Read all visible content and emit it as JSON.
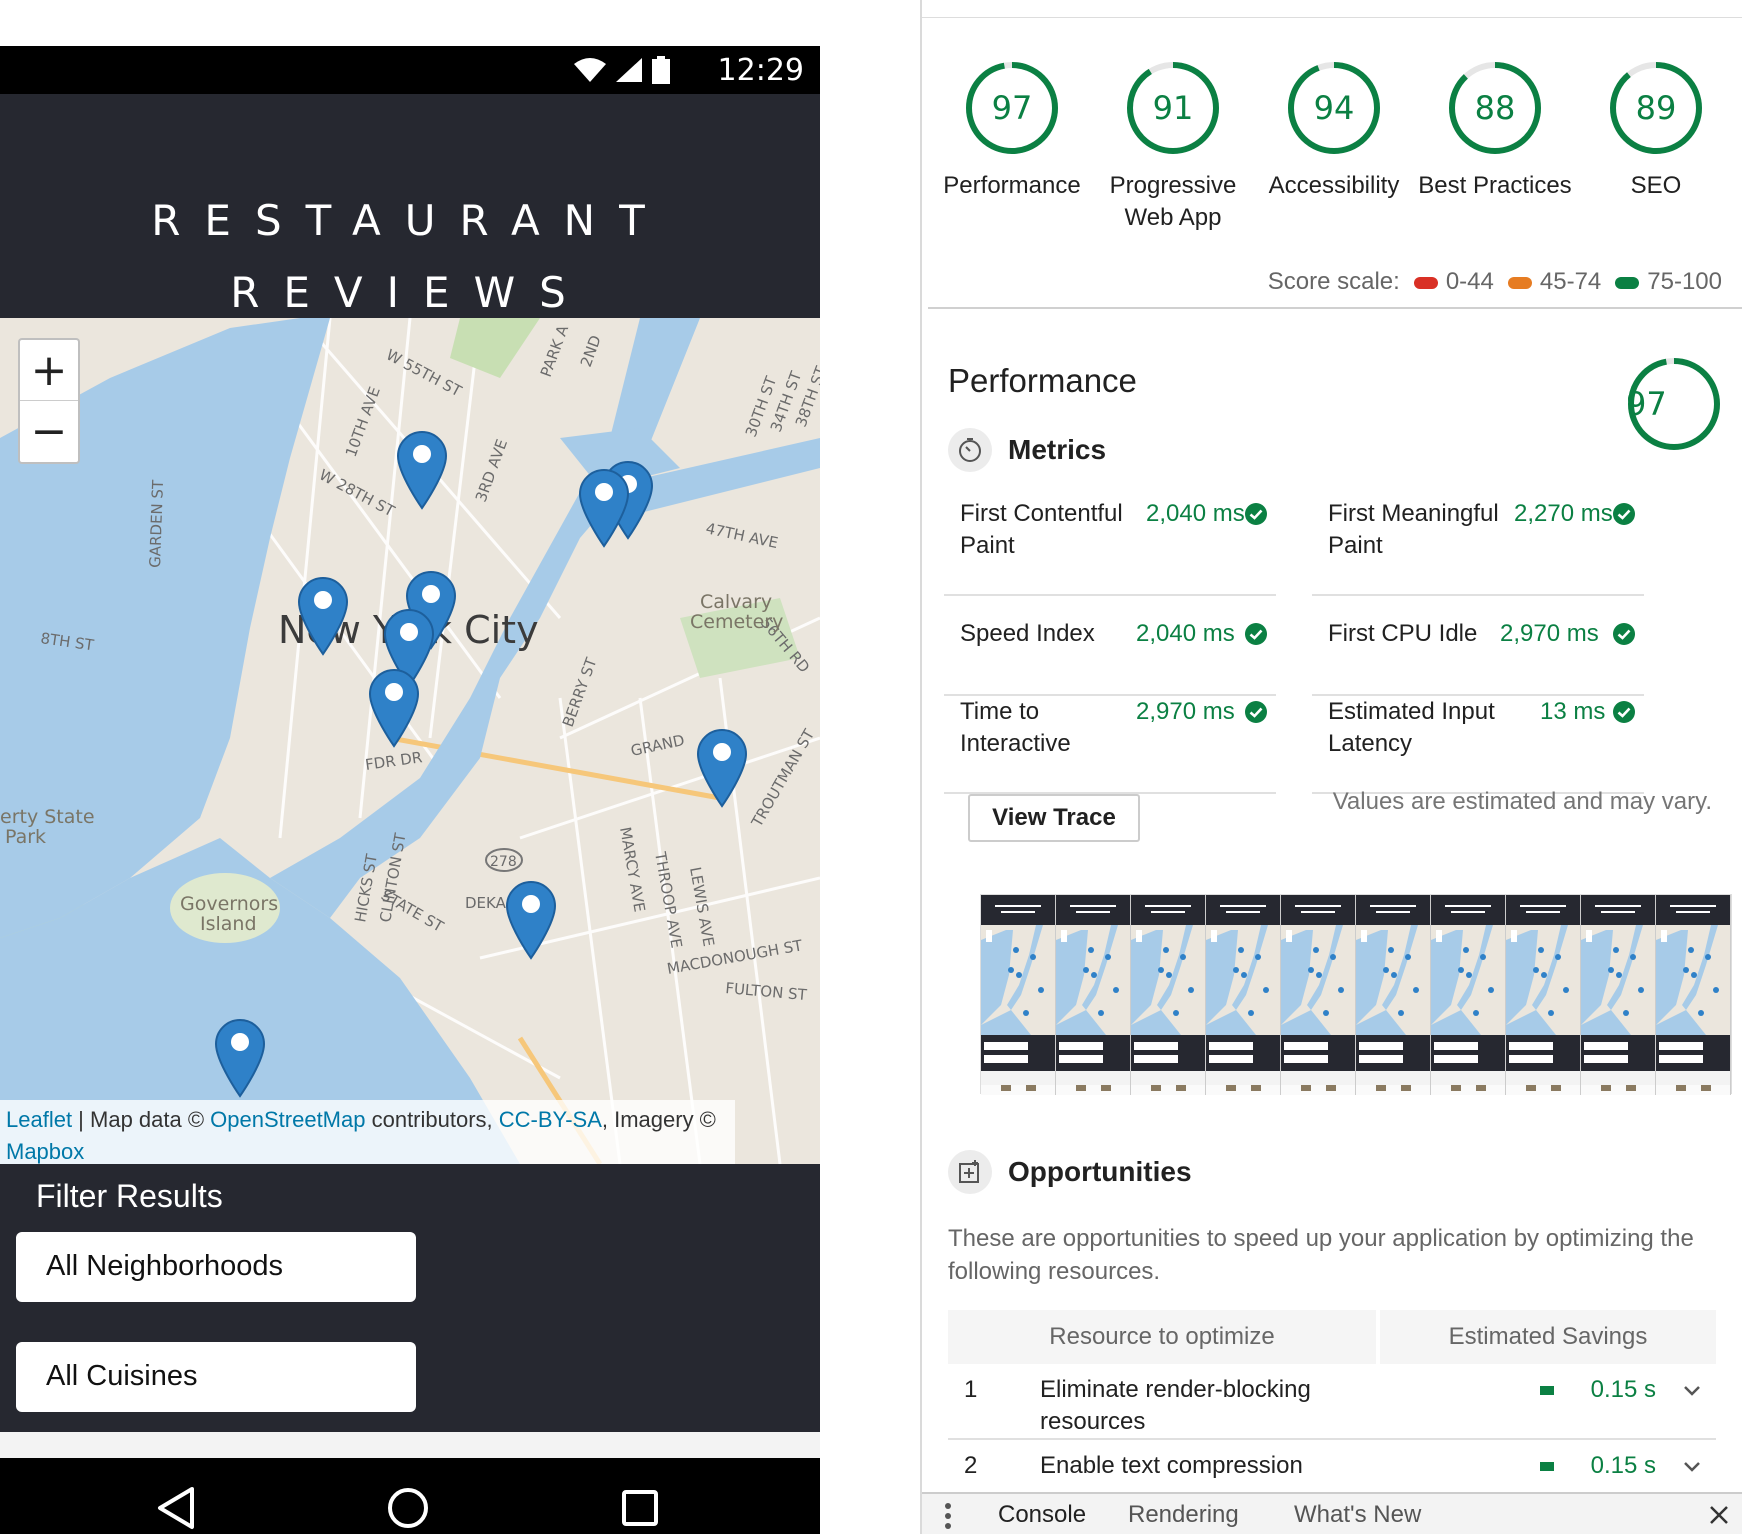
{
  "phone": {
    "status_time": "12:29",
    "app_title_line1": "RESTAURANT",
    "app_title_line2": "REVIEWS",
    "map": {
      "zoom_in": "+",
      "zoom_out": "−",
      "city_label": "New York City",
      "street_labels": [
        "W 55TH ST",
        "10TH AVE",
        "W 28TH ST",
        "3RD AVE",
        "PARK A",
        "2ND",
        "30TH ST",
        "34TH ST",
        "38TH ST",
        "47TH AVE",
        "Calvary Cemetery",
        "56TH RD",
        "GARDEN ST",
        "8TH ST",
        "BERRY ST",
        "GRAND",
        "TROUTMAN ST",
        "FDR DR",
        "erty State Park",
        "Governors Island",
        "HICKS ST",
        "CLINTON ST",
        "STATE ST",
        "DEKA",
        "MARCY AVE",
        "THROOP AVE",
        "LEWIS AVE",
        "MACDONOUGH ST",
        "FULTON ST",
        "278"
      ],
      "attribution": {
        "leaflet": "Leaflet",
        "sep1": " | Map data © ",
        "osm": "OpenStreetMap",
        "sep2": " contributors, ",
        "license": "CC-BY-SA",
        "sep3": ", Imagery © ",
        "mapbox": "Mapbox"
      }
    },
    "filter": {
      "title": "Filter Results",
      "neighborhoods": "All Neighborhoods",
      "cuisines": "All Cuisines"
    }
  },
  "lighthouse": {
    "gauges": [
      {
        "score": 97,
        "label": "Performance"
      },
      {
        "score": 91,
        "label": "Progressive Web App"
      },
      {
        "score": 94,
        "label": "Accessibility"
      },
      {
        "score": 88,
        "label": "Best Practices"
      },
      {
        "score": 89,
        "label": "SEO"
      }
    ],
    "score_scale": {
      "label": "Score scale:",
      "ranges": [
        {
          "range": "0-44",
          "color": "#d93025"
        },
        {
          "range": "45-74",
          "color": "#e67c22"
        },
        {
          "range": "75-100",
          "color": "#0b8043"
        }
      ]
    },
    "performance": {
      "title": "Performance",
      "score": 97,
      "metrics_title": "Metrics",
      "metrics": [
        {
          "name_line1": "First Contentful",
          "name_line2": "Paint",
          "value": "2,040 ms"
        },
        {
          "name_line1": "First Meaningful",
          "name_line2": "Paint",
          "value": "2,270 ms"
        },
        {
          "name_line1": "Speed Index",
          "name_line2": "",
          "value": "2,040 ms"
        },
        {
          "name_line1": "First CPU Idle",
          "name_line2": "",
          "value": "2,970 ms"
        },
        {
          "name_line1": "Time to",
          "name_line2": "Interactive",
          "value": "2,970 ms"
        },
        {
          "name_line1": "Estimated Input",
          "name_line2": "Latency",
          "value": "13 ms"
        }
      ],
      "view_trace": "View Trace",
      "estimate_note": "Values are estimated and may vary."
    },
    "opportunities": {
      "title": "Opportunities",
      "description": "These are opportunities to speed up your application by optimizing the following resources.",
      "col_resource": "Resource to optimize",
      "col_savings": "Estimated Savings",
      "rows": [
        {
          "num": "1",
          "label": "Eliminate render-blocking resources",
          "savings": "0.15 s"
        },
        {
          "num": "2",
          "label": "Enable text compression",
          "savings": "0.15 s"
        }
      ]
    },
    "drawer": {
      "tabs": [
        "Console",
        "Rendering",
        "What's New"
      ]
    }
  },
  "colors": {
    "pass_green": "#0b8043",
    "app_dark": "#262830",
    "water": "#a7cbe8",
    "marker": "#2f81c8"
  }
}
